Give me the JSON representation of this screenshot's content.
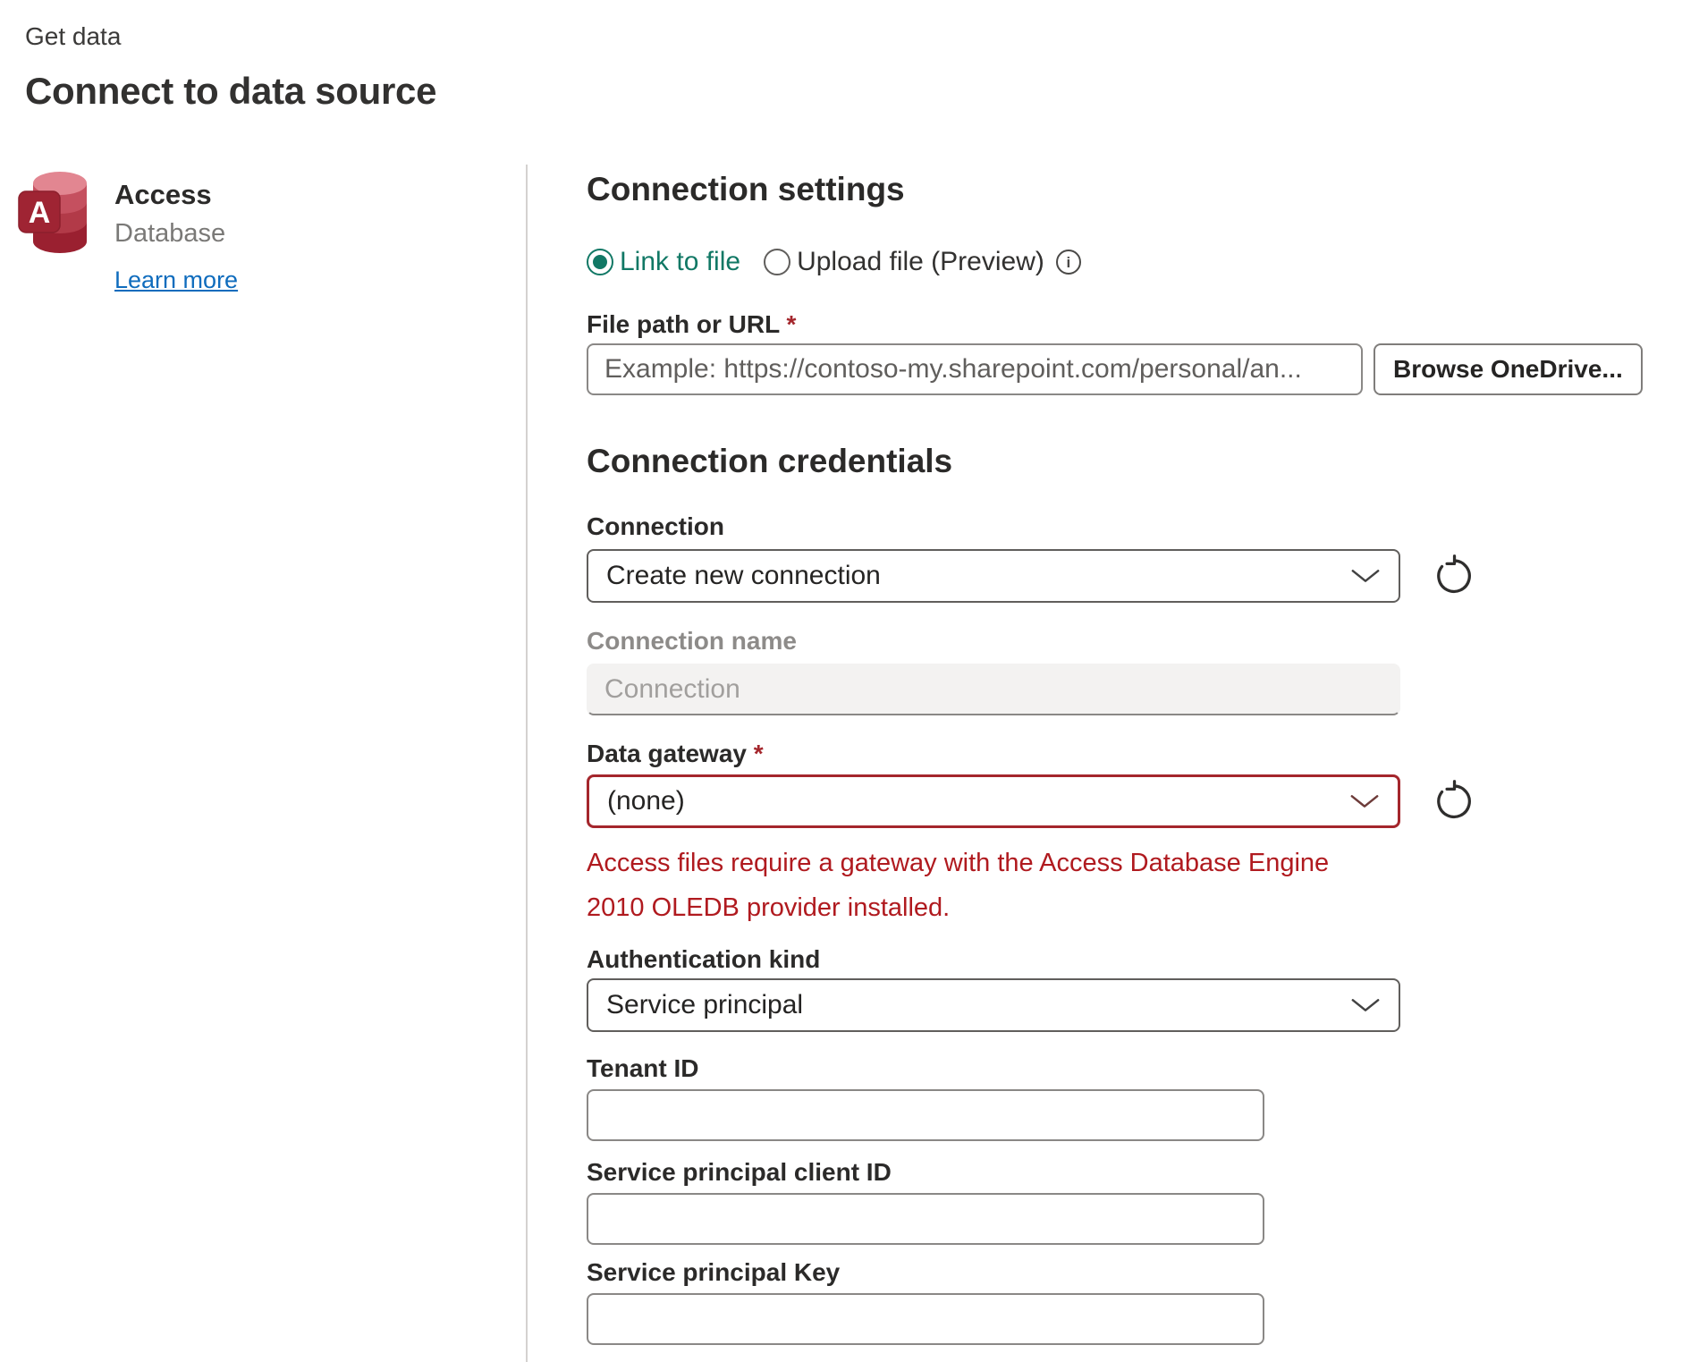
{
  "page": {
    "breadcrumb": "Get data",
    "title": "Connect to data source"
  },
  "connector": {
    "name": "Access",
    "type": "Database",
    "learn_more_label": "Learn more",
    "icon": "access-database-icon"
  },
  "connection_settings": {
    "heading": "Connection settings",
    "radio_options": [
      {
        "label": "Link to file",
        "selected": true
      },
      {
        "label": "Upload file (Preview)",
        "selected": false
      }
    ],
    "file_path": {
      "label": "File path or URL",
      "required_marker": "*",
      "placeholder": "Example: https://contoso-my.sharepoint.com/personal/an...",
      "value": ""
    },
    "browse_button_label": "Browse OneDrive..."
  },
  "connection_credentials": {
    "heading": "Connection credentials",
    "connection": {
      "label": "Connection",
      "selected_value": "Create new connection"
    },
    "connection_name": {
      "label": "Connection name",
      "placeholder": "Connection",
      "value": "",
      "disabled": true
    },
    "data_gateway": {
      "label": "Data gateway",
      "required_marker": "*",
      "selected_value": "(none)",
      "error_message": "Access files require a gateway with the Access Database Engine 2010 OLEDB provider installed."
    },
    "authentication_kind": {
      "label": "Authentication kind",
      "selected_value": "Service principal"
    },
    "tenant_id": {
      "label": "Tenant ID",
      "value": ""
    },
    "service_principal_client_id": {
      "label": "Service principal client ID",
      "value": ""
    },
    "service_principal_key": {
      "label": "Service principal Key",
      "value": ""
    }
  },
  "colors": {
    "accent_teal": "#117865",
    "error_red": "#a4262c",
    "error_text": "#b01a1f",
    "link_blue": "#0f6cbd"
  }
}
